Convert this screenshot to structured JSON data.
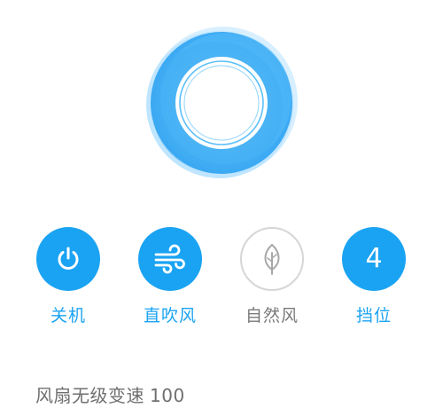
{
  "colors": {
    "accent": "#1aa3f2",
    "fan_outer": "#5cc0f8",
    "fan_inner_ring": "#ffffff",
    "inactive_border": "#d6d6d6",
    "inactive_text": "#7a7a7a",
    "text_muted": "#6f6f6f",
    "background": "#ffffff"
  },
  "fan": {
    "icon": "fan-blade-icon"
  },
  "controls": [
    {
      "label": "关机",
      "icon": "power-icon",
      "active": true
    },
    {
      "label": "直吹风",
      "icon": "wind-icon",
      "active": true
    },
    {
      "label": "自然风",
      "icon": "leaf-icon",
      "active": false
    },
    {
      "label": "挡位",
      "icon": "gear-number",
      "value": "4",
      "active": true
    }
  ],
  "speed": {
    "label": "风扇无级变速",
    "value": "100"
  }
}
